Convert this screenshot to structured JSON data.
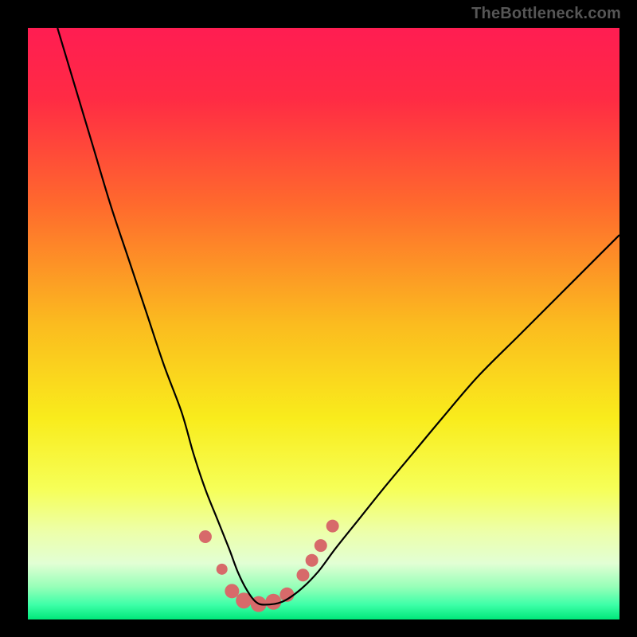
{
  "watermark": "TheBottleneck.com",
  "chart_data": {
    "type": "line",
    "title": "",
    "xlabel": "",
    "ylabel": "",
    "xlim": [
      0,
      100
    ],
    "ylim": [
      0,
      100
    ],
    "gradient_stops": [
      {
        "offset": 0.0,
        "color": "#ff1d52"
      },
      {
        "offset": 0.12,
        "color": "#ff2b44"
      },
      {
        "offset": 0.3,
        "color": "#ff6a2d"
      },
      {
        "offset": 0.5,
        "color": "#fbbb1f"
      },
      {
        "offset": 0.66,
        "color": "#f9ec1c"
      },
      {
        "offset": 0.78,
        "color": "#f6ff58"
      },
      {
        "offset": 0.85,
        "color": "#edffa8"
      },
      {
        "offset": 0.905,
        "color": "#e2ffd4"
      },
      {
        "offset": 0.945,
        "color": "#96ffb8"
      },
      {
        "offset": 0.975,
        "color": "#3effa8"
      },
      {
        "offset": 1.0,
        "color": "#00e77a"
      }
    ],
    "series": [
      {
        "name": "bottleneck-curve",
        "color": "#000000",
        "x": [
          5,
          8,
          11,
          14,
          17,
          20,
          23,
          26,
          28,
          30,
          32,
          34,
          35.5,
          37,
          38.5,
          40,
          43,
          46,
          49,
          52,
          56,
          60,
          65,
          70,
          76,
          83,
          90,
          97,
          100
        ],
        "y": [
          100,
          90,
          80,
          70,
          61,
          52,
          43,
          35,
          28,
          22,
          17,
          12,
          8,
          5,
          3,
          2.5,
          3,
          5,
          8,
          12,
          17,
          22,
          28,
          34,
          41,
          48,
          55,
          62,
          65
        ]
      }
    ],
    "markers": {
      "name": "highlight-dots",
      "color": "#d76a6a",
      "points": [
        {
          "x": 30.0,
          "y": 14.0,
          "r": 8
        },
        {
          "x": 32.8,
          "y": 8.5,
          "r": 7
        },
        {
          "x": 34.5,
          "y": 4.8,
          "r": 9
        },
        {
          "x": 36.5,
          "y": 3.2,
          "r": 10
        },
        {
          "x": 39.0,
          "y": 2.6,
          "r": 10
        },
        {
          "x": 41.5,
          "y": 3.0,
          "r": 10
        },
        {
          "x": 43.8,
          "y": 4.2,
          "r": 9
        },
        {
          "x": 46.5,
          "y": 7.5,
          "r": 8
        },
        {
          "x": 48.0,
          "y": 10.0,
          "r": 8
        },
        {
          "x": 49.5,
          "y": 12.5,
          "r": 8
        },
        {
          "x": 51.5,
          "y": 15.8,
          "r": 8
        }
      ]
    }
  }
}
